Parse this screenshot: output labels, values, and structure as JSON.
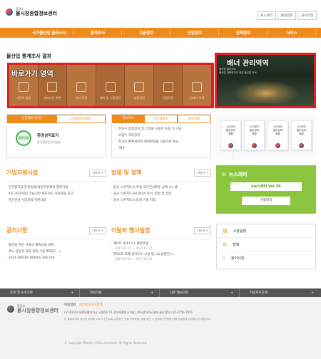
{
  "header": {
    "logo_sub": "환경부",
    "logo_main": "물시장종합정보센터",
    "buttons": [
      "뉴스레터",
      "통합검색",
      "사이트맵"
    ]
  },
  "nav": {
    "items": [
      "국가물산업 클러스터",
      "통계조사",
      "기술정보",
      "산업정보",
      "정책정보",
      "서비스"
    ]
  },
  "page_title": "물산업 통계조사 결과",
  "quick_area": {
    "overlay": "바로가기 영역",
    "items": [
      "사진북 열람",
      "새미나정 관련",
      "인터 관련",
      "해외 및 인증관련",
      "상장관련",
      "인증관련",
      "전체이 관련"
    ]
  },
  "banner": {
    "overlay": "배너 관리역역",
    "caption_1": "물산업 클러스터",
    "caption_2": "물산업 대한민국의 대표 물산업 허브"
  },
  "cert_panel": {
    "tabs": [
      "인증정보(주체)",
      "인증정보(해외)"
    ],
    "badge": "환경인증",
    "title": "환경성적표지",
    "subtitle": "한국환경산업기술원"
  },
  "news_panel": {
    "tabs": [
      "지속회보",
      "신기술정보",
      "정규자료"
    ],
    "items": [
      "진동수 조정장치 및 그것을 사용한 수중 식 구당",
      "오염수 처리장치",
      "참기리 환해처리와 템버판점을 사용하여 총공",
      "배수"
    ]
  },
  "books": [
    {
      "line1": "2016년",
      "line2": "물산업의",
      "line3": "현황"
    },
    {
      "line1": "2016년",
      "line2": "물산업의",
      "line3": "현황"
    },
    {
      "line1": "2016년",
      "line2": "물산업의",
      "line3": "현황"
    },
    {
      "line1": "2016년",
      "line2": "물산업의",
      "line3": "현황"
    }
  ],
  "support": {
    "title": "기업지원사업",
    "more": "더보기 +",
    "items": [
      "인간창작공간(작업실)창업지원센터 참여기업",
      "4차 3D프린팅 기술기반 제조혁신 지원사업 공고",
      "혁신건설 시장개척 지원사업"
    ]
  },
  "policy": {
    "title": "법령 및 정책",
    "more": "더보기 +",
    "items": [
      "중국 스폰지도시 조성 국가건설표준 설계 시스템",
      "중국 스폰지도시(LID)의 하이, 방법 및 전망",
      "중국 스폰지도시 조성 기술 지침"
    ]
  },
  "newsletter": {
    "title": "뉴스레터",
    "subtitle": "e뉴스레터 Vol.30",
    "button": "신청하기"
  },
  "notice": {
    "title": "공지사항",
    "more": "더보기 +",
    "items": [
      "물산업 관련 기술의 해외보급 대회",
      "쿠닉 상승과 국화 강화 시장 확대(도...)",
      "2016 WATER KOREA 개최 안내"
    ]
  },
  "events": {
    "title": "이달의 행사일정",
    "more": "더보기 +",
    "items": [
      {
        "name": "제6차 국제 CCS 환경포럼",
        "date": "2017-07-27 ~ 2017-07-27"
      },
      {
        "name": "제15회 국제 상하수도 시설 및 나노융합전시",
        "date": "2017-07-24 ~ 2017-07-31"
      }
    ]
  },
  "links": {
    "items": [
      "시장동향",
      "법령",
      "용어사전"
    ]
  },
  "footbar": {
    "items": [
      "유관 및 소속기관",
      "관련기관",
      "다른 웹사이트",
      "지방자치단체"
    ]
  },
  "footer": {
    "logo_sub": "환경부",
    "logo_main": "물시장종합정보센터",
    "links": [
      "이용약관",
      "개인정보보호정책"
    ],
    "address": "(우)30103 세종특별자치시 도움6로 11 정부세종청사 6동 | 한국상하수도협회 물산업팀 | 02-3156-7851",
    "notice": "본 홈페이지에 게시된 이메일 주소가 무단으로 수집되는 것을 거부하며, 이를 위반 시 정보통신망법에 의해 처벌됨을 유념하시기 바랍니다.",
    "copyright": "© Copyright Ministry of Environment. All Rights Reserved."
  }
}
